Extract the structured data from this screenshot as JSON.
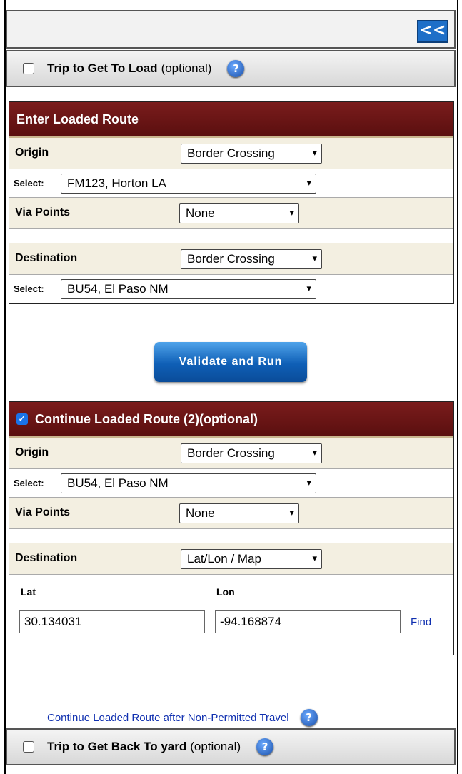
{
  "collapse_label": "<<",
  "top_trip": {
    "label": "Trip to Get To Load",
    "optional": "(optional)",
    "checked": false
  },
  "loaded": {
    "title": "Enter Loaded Route",
    "origin_label": "Origin",
    "origin_value": "Border Crossing",
    "origin_select_label": "Select:",
    "origin_select_value": "FM123, Horton LA",
    "via_label": "Via Points",
    "via_value": "None",
    "dest_label": "Destination",
    "dest_value": "Border Crossing",
    "dest_select_label": "Select:",
    "dest_select_value": "BU54, El Paso NM"
  },
  "validate_label": "Validate and Run",
  "continue": {
    "title": "Continue Loaded Route (2)(optional)",
    "checked": true,
    "origin_label": "Origin",
    "origin_value": "Border Crossing",
    "origin_select_label": "Select:",
    "origin_select_value": "BU54, El Paso NM",
    "via_label": "Via Points",
    "via_value": "None",
    "dest_label": "Destination",
    "dest_value": "Lat/Lon / Map",
    "lat_label": "Lat",
    "lon_label": "Lon",
    "lat_value": "30.134031",
    "lon_value": "-94.168874",
    "find_label": "Find"
  },
  "non_permitted_link": "Continue Loaded Route after Non-Permitted Travel",
  "back_trip": {
    "label": "Trip to Get Back To yard",
    "optional": "(optional)",
    "checked": false
  },
  "help_glyph": "?",
  "dropdown_glyph": "▾",
  "check_glyph": "✓",
  "colors": {
    "panel_header": "#6b1515",
    "row_beige": "#f3efe1",
    "button_blue": "#1e6fc8",
    "link": "#1030b0"
  }
}
